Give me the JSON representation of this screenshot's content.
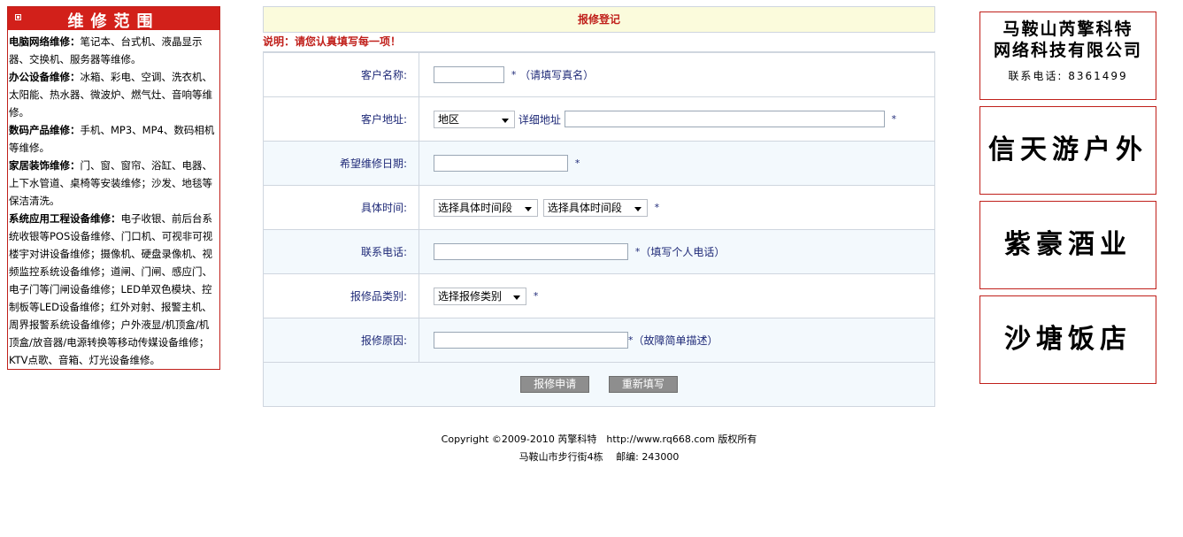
{
  "left": {
    "header": "维修范围",
    "items": [
      {
        "title": "电脑网络维修：",
        "text": "笔记本、台式机、液晶显示器、交换机、服务器等维修。"
      },
      {
        "title": "办公设备维修：",
        "text": "冰箱、彩电、空调、洗衣机、太阳能、热水器、微波炉、燃气灶、音响等维修。"
      },
      {
        "title": "数码产品维修：",
        "text": "手机、MP3、MP4、数码相机等维修。"
      },
      {
        "title": "家居装饰维修：",
        "text": "门、窗、窗帘、浴缸、电器、上下水管道、桌椅等安装维修；沙发、地毯等保洁清洗。"
      },
      {
        "title": "系统应用工程设备维修：",
        "text": "电子收银、前后台系统收银等POS设备维修、门口机、可视非可视楼宇对讲设备维修；摄像机、硬盘录像机、视频监控系统设备维修；道闸、门闸、感应门、电子门等门闸设备维修；LED单双色模块、控制板等LED设备维修；红外对射、报警主机、周界报警系统设备维修；户外液显/机顶盒/机顶盒/放音器/电源转换等移动传媒设备维修；KTV点歌、音箱、灯光设备维修。"
      }
    ]
  },
  "form": {
    "title": "报修登记",
    "note": "说明：请您认真填写每一项！",
    "fields": {
      "name_label": "客户名称:",
      "name_hint": "（请填写真名）",
      "address_label": "客户地址:",
      "region_select": "地区",
      "detail_label": "详细地址",
      "date_label": "希望维修日期:",
      "time_label": "具体时间:",
      "time_select_1": "选择具体时间段",
      "time_select_2": "选择具体时间段",
      "phone_label": "联系电话:",
      "phone_hint": "（填写个人电话）",
      "category_label": "报修品类别:",
      "category_select": "选择报修类别",
      "reason_label": "报修原因:",
      "reason_hint": "（故障简单描述）",
      "star": "*"
    },
    "submit_label": "报修申请",
    "reset_label": "重新填写"
  },
  "footer": {
    "line1": "Copyright ©2009-2010 芮擎科特　http://www.rq668.com 版权所有",
    "line2": "马鞍山市步行街4栋　 邮编: 243000"
  },
  "ads": {
    "ad1_line1": "马鞍山芮擎科特",
    "ad1_line2": "网络科技有限公司",
    "ad1_line3": "联系电话: 8361499",
    "ad2": "信天游户外",
    "ad3": "紫豪酒业",
    "ad4": "沙塘饭店"
  },
  "colors": {
    "accent_red": "#d2201a",
    "label_blue": "#1f2a78",
    "title_bg": "#fbfbdc"
  }
}
